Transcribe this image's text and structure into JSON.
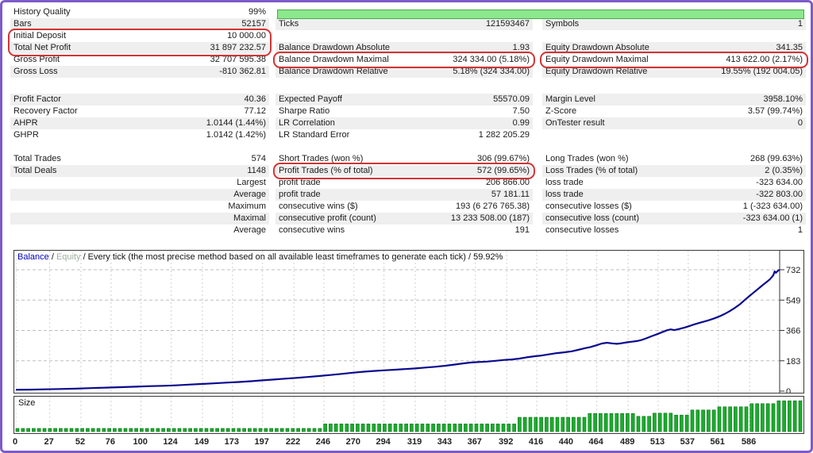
{
  "stats": {
    "sections": [
      {
        "top": 5,
        "shadeEven": false,
        "rows": [
          {
            "l": [
              "History Quality",
              "99%"
            ],
            "m": null,
            "r": null
          },
          {
            "l": [
              "Bars",
              "52157"
            ],
            "m": [
              "Ticks",
              "121593467"
            ],
            "r": [
              "Symbols",
              "1"
            ]
          },
          {
            "l": [
              "Initial Deposit",
              "10 000.00"
            ],
            "m": null,
            "r": null
          },
          {
            "l": [
              "Total Net Profit",
              "31 897 232.57"
            ],
            "m": [
              "Balance Drawdown Absolute",
              "1.93"
            ],
            "r": [
              "Equity Drawdown Absolute",
              "341.35"
            ]
          },
          {
            "l": [
              "Gross Profit",
              "32 707 595.38"
            ],
            "m": [
              "Balance Drawdown Maximal",
              "324 334.00 (5.18%)"
            ],
            "r": [
              "Equity Drawdown Maximal",
              "413 622.00 (2.17%)"
            ]
          },
          {
            "l": [
              "Gross Loss",
              "-810 362.81"
            ],
            "m": [
              "Balance Drawdown Relative",
              "5.18% (324 334.00)"
            ],
            "r": [
              "Equity Drawdown Relative",
              "19.55% (192 004.05)"
            ]
          }
        ]
      },
      {
        "top": 115,
        "shadeEven": true,
        "rows": [
          {
            "l": [
              "Profit Factor",
              "40.36"
            ],
            "m": [
              "Expected Payoff",
              "55570.09"
            ],
            "r": [
              "Margin Level",
              "3958.10%"
            ]
          },
          {
            "l": [
              "Recovery Factor",
              "77.12"
            ],
            "m": [
              "Sharpe Ratio",
              "7.50"
            ],
            "r": [
              "Z-Score",
              "3.57 (99.74%)"
            ]
          },
          {
            "l": [
              "AHPR",
              "1.0144 (1.44%)"
            ],
            "m": [
              "LR Correlation",
              "0.99"
            ],
            "r": [
              "OnTester result",
              "0"
            ]
          },
          {
            "l": [
              "GHPR",
              "1.0142 (1.42%)"
            ],
            "m": [
              "LR Standard Error",
              "1 282 205.29"
            ],
            "r": null
          }
        ]
      },
      {
        "top": 190,
        "shadeEven": false,
        "rows": [
          {
            "l": [
              "Total Trades",
              "574"
            ],
            "m": [
              "Short Trades (won %)",
              "306 (99.67%)"
            ],
            "r": [
              "Long Trades (won %)",
              "268 (99.63%)"
            ]
          },
          {
            "l": [
              "Total Deals",
              "1148"
            ],
            "m": [
              "Profit Trades (% of total)",
              "572 (99.65%)"
            ],
            "r": [
              "Loss Trades (% of total)",
              "2 (0.35%)"
            ]
          },
          {
            "l": [
              "",
              "Largest"
            ],
            "m": [
              "profit trade",
              "206 866.00"
            ],
            "r": [
              "loss trade",
              "-323 634.00"
            ]
          },
          {
            "l": [
              "",
              "Average"
            ],
            "m": [
              "profit trade",
              "57 181.11"
            ],
            "r": [
              "loss trade",
              "-322 803.00"
            ]
          },
          {
            "l": [
              "",
              "Maximum"
            ],
            "m": [
              "consecutive wins ($)",
              "193 (6 276 765.38)"
            ],
            "r": [
              "consecutive losses ($)",
              "1 (-323 634.00)"
            ]
          },
          {
            "l": [
              "",
              "Maximal"
            ],
            "m": [
              "consecutive profit (count)",
              "13 233 508.00 (187)"
            ],
            "r": [
              "consecutive loss (count)",
              "-323 634.00 (1)"
            ]
          },
          {
            "l": [
              "",
              "Average"
            ],
            "m": [
              "consecutive wins",
              "191"
            ],
            "r": [
              "consecutive losses",
              "1"
            ]
          }
        ]
      }
    ]
  },
  "colors": {
    "accent_border": "#7e5bc8",
    "highlight_red": "#d23434",
    "progress_green_fill": "#8ce88c",
    "progress_green_border": "#4aa94a",
    "balance_line": "#09098e",
    "size_bar_fill": "#17b02b",
    "size_bar_stroke": "#0c6b17",
    "row_shade": "#efefef",
    "grid": "#c6c6c6"
  },
  "chart_data": {
    "type": "line",
    "title": {
      "balance": "Balance",
      "sep1": " / ",
      "equity": "Equity",
      "rest": " / Every tick (the most precise method based on all available least timeframes to generate each tick) / 59.92%"
    },
    "size_label": "Size",
    "legend_position": "top-left",
    "grid": true,
    "x_ticks": [
      0,
      27,
      52,
      76,
      100,
      124,
      149,
      173,
      197,
      222,
      246,
      270,
      294,
      319,
      343,
      367,
      392,
      416,
      440,
      464,
      489,
      513,
      537,
      561,
      586
    ],
    "y_ticks": [
      0,
      183,
      366,
      549,
      732
    ],
    "x_range": [
      0,
      610
    ],
    "y_range": [
      0,
      845
    ],
    "balance_series": [
      [
        0,
        8
      ],
      [
        12,
        9
      ],
      [
        24,
        11
      ],
      [
        36,
        13
      ],
      [
        48,
        15
      ],
      [
        60,
        18
      ],
      [
        72,
        21
      ],
      [
        84,
        24
      ],
      [
        96,
        27
      ],
      [
        108,
        30
      ],
      [
        118,
        32
      ],
      [
        128,
        35
      ],
      [
        138,
        39
      ],
      [
        148,
        43
      ],
      [
        158,
        47
      ],
      [
        168,
        51
      ],
      [
        178,
        55
      ],
      [
        188,
        60
      ],
      [
        197,
        65
      ],
      [
        206,
        70
      ],
      [
        215,
        75
      ],
      [
        224,
        80
      ],
      [
        233,
        85
      ],
      [
        242,
        91
      ],
      [
        251,
        97
      ],
      [
        260,
        104
      ],
      [
        269,
        111
      ],
      [
        278,
        117
      ],
      [
        287,
        122
      ],
      [
        295,
        126
      ],
      [
        303,
        129
      ],
      [
        311,
        133
      ],
      [
        319,
        137
      ],
      [
        327,
        142
      ],
      [
        335,
        147
      ],
      [
        343,
        153
      ],
      [
        350,
        160
      ],
      [
        357,
        167
      ],
      [
        363,
        172
      ],
      [
        369,
        175
      ],
      [
        376,
        178
      ],
      [
        383,
        183
      ],
      [
        390,
        188
      ],
      [
        396,
        191
      ],
      [
        402,
        196
      ],
      [
        408,
        204
      ],
      [
        414,
        210
      ],
      [
        420,
        215
      ],
      [
        426,
        222
      ],
      [
        432,
        229
      ],
      [
        438,
        234
      ],
      [
        444,
        240
      ],
      [
        449,
        249
      ],
      [
        454,
        258
      ],
      [
        459,
        266
      ],
      [
        464,
        277
      ],
      [
        468,
        287
      ],
      [
        472,
        292
      ],
      [
        476,
        288
      ],
      [
        480,
        285
      ],
      [
        484,
        289
      ],
      [
        488,
        294
      ],
      [
        492,
        298
      ],
      [
        496,
        302
      ],
      [
        500,
        309
      ],
      [
        504,
        320
      ],
      [
        508,
        332
      ],
      [
        512,
        343
      ],
      [
        516,
        355
      ],
      [
        520,
        367
      ],
      [
        523,
        372
      ],
      [
        526,
        368
      ],
      [
        530,
        375
      ],
      [
        534,
        383
      ],
      [
        538,
        393
      ],
      [
        542,
        403
      ],
      [
        546,
        412
      ],
      [
        550,
        420
      ],
      [
        554,
        429
      ],
      [
        558,
        439
      ],
      [
        562,
        451
      ],
      [
        566,
        465
      ],
      [
        570,
        482
      ],
      [
        574,
        501
      ],
      [
        578,
        522
      ],
      [
        582,
        549
      ],
      [
        586,
        574
      ],
      [
        590,
        599
      ],
      [
        594,
        624
      ],
      [
        597,
        643
      ],
      [
        600,
        660
      ],
      [
        602,
        673
      ],
      [
        604,
        690
      ],
      [
        605,
        700
      ],
      [
        606,
        722
      ],
      [
        607,
        714
      ],
      [
        608,
        721
      ],
      [
        609,
        728
      ],
      [
        610,
        731
      ]
    ],
    "size_profile": [
      [
        0,
        243,
        0.1
      ],
      [
        243,
        398,
        0.24
      ],
      [
        398,
        458,
        0.45
      ],
      [
        458,
        493,
        0.57
      ],
      [
        493,
        506,
        0.48
      ],
      [
        506,
        524,
        0.58
      ],
      [
        524,
        538,
        0.52
      ],
      [
        538,
        561,
        0.68
      ],
      [
        561,
        584,
        0.78
      ],
      [
        584,
        605,
        0.88
      ],
      [
        605,
        632,
        0.97
      ]
    ]
  }
}
